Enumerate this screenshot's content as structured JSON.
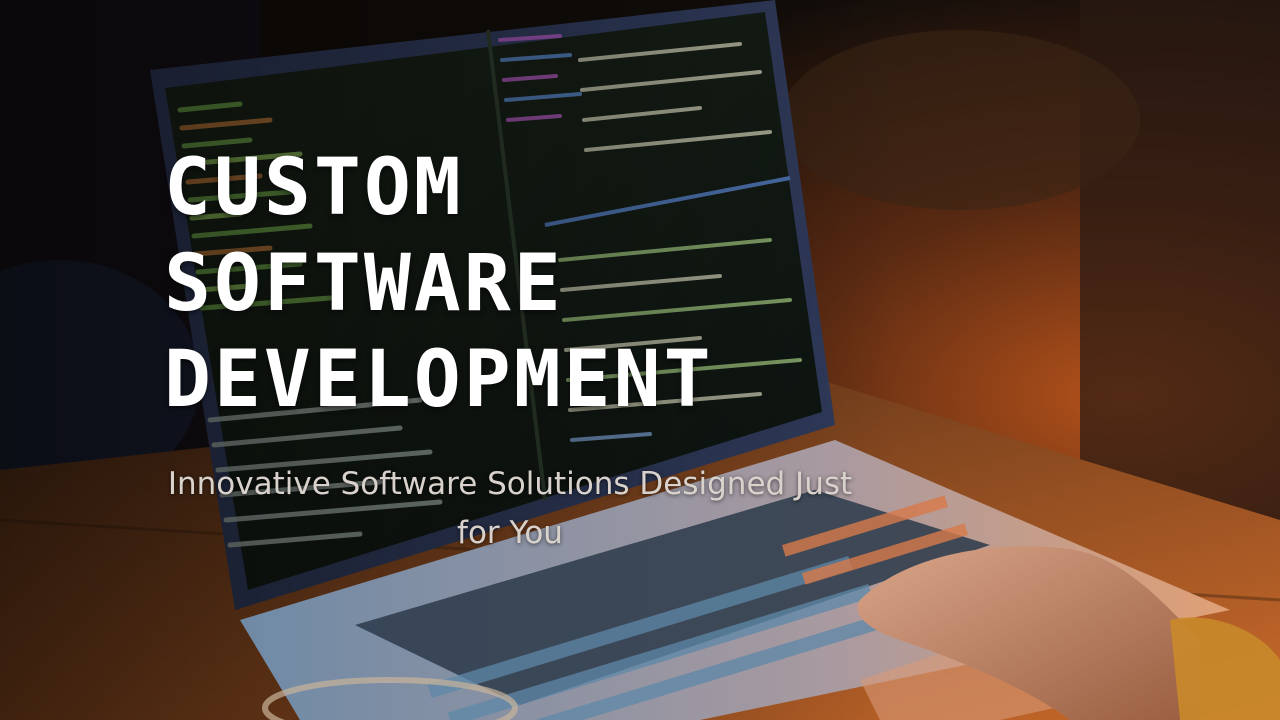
{
  "hero": {
    "title_lines": [
      "CUSTOM",
      "SOFTWARE",
      "DEVELOPMENT"
    ],
    "subtitle": "Innovative Software Solutions Designed Just for You"
  },
  "photo": {
    "subject": "laptop-with-code-terminal",
    "colors": {
      "warm_light": "#e07a2a",
      "terminal_green": "#7fbf4a",
      "keyboard_blue": "#3a6f8f",
      "dark_bg": "#14100c"
    }
  }
}
